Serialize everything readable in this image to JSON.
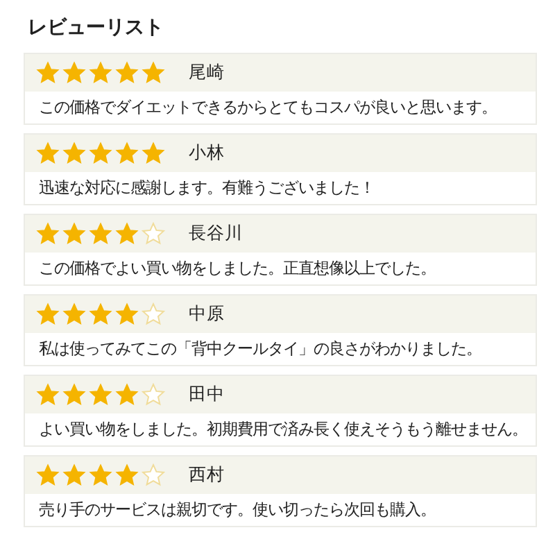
{
  "title": "レビューリスト",
  "reviews": [
    {
      "stars": 5,
      "name": "尾崎",
      "comment": "この価格でダイエットできるからとてもコスパが良いと思います。"
    },
    {
      "stars": 5,
      "name": "小林",
      "comment": "迅速な対応に感謝します。有難うございました！"
    },
    {
      "stars": 4,
      "name": "長谷川",
      "comment": "この価格でよい買い物をしました。正直想像以上でした。"
    },
    {
      "stars": 4,
      "name": "中原",
      "comment": "私は使ってみてこの「背中クールタイ」の良さがわかりました。"
    },
    {
      "stars": 4,
      "name": "田中",
      "comment": "よい買い物をしました。初期費用で済み長く使えそうもう離せません。"
    },
    {
      "stars": 4,
      "name": "西村",
      "comment": "売り手のサービスは親切です。使い切ったら次回も購入。"
    }
  ]
}
